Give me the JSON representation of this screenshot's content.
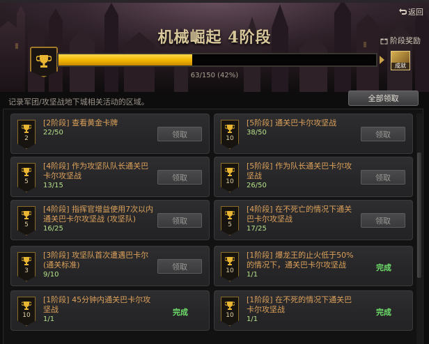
{
  "header": {
    "back_label": "返回",
    "title": "机械崛起 4阶段",
    "reward_label": "阶段奖励",
    "progress": {
      "current": 63,
      "total": 150,
      "percent": 42,
      "text": "63/150 (42%)"
    },
    "achievement_badge_label": "成就"
  },
  "description": "记录军团/攻坚战地下城相关活动的区域。",
  "claim_all_label": "全部领取",
  "colors": {
    "accent_gold": "#f0b400",
    "title": "#d8c79a",
    "task_name": "#dca15a",
    "progress_text": "#b7e18a",
    "complete": "#6ee06b"
  },
  "tasks": [
    {
      "level": "2",
      "name": "[2阶段] 查看黄金卡牌",
      "progress": "22/50",
      "status": "claim",
      "status_label": "领取"
    },
    {
      "level": "10",
      "name": "[5阶段] 通关巴卡尔攻坚战",
      "progress": "38/50",
      "status": "claim",
      "status_label": "领取"
    },
    {
      "level": "5",
      "name": "[4阶段] 作为攻坚队队长通关巴卡尔攻坚战",
      "progress": "13/15",
      "status": "claim",
      "status_label": "领取"
    },
    {
      "level": "10",
      "name": "[5阶段] 作为队长通关巴卡尔攻坚战",
      "progress": "26/50",
      "status": "claim",
      "status_label": "领取"
    },
    {
      "level": "5",
      "name": "[4阶段] 指挥官增益使用7次以内通关巴卡尔攻坚战 (攻坚队)",
      "progress": "16/25",
      "status": "claim",
      "status_label": "领取"
    },
    {
      "level": "5",
      "name": "[4阶段] 在不死亡的情况下通关巴卡尔攻坚战",
      "progress": "17/25",
      "status": "claim",
      "status_label": "领取"
    },
    {
      "level": "3",
      "name": "[3阶段] 攻坚队首次遭遇巴卡尔 (通关标准)",
      "progress": "9/10",
      "status": "claim",
      "status_label": "领取"
    },
    {
      "level": "10",
      "name": "[1阶段] 爆龙王的止火低于50%的情况下，通关巴卡尔攻坚战",
      "progress": "1/1",
      "status": "complete",
      "status_label": "完成"
    },
    {
      "level": "10",
      "name": "[1阶段] 45分钟内通关巴卡尔攻坚战",
      "progress": "1/1",
      "status": "complete",
      "status_label": "完成"
    },
    {
      "level": "10",
      "name": "[1阶段] 在不死的情况下通关巴卡尔攻坚战",
      "progress": "1/1",
      "status": "complete",
      "status_label": "完成"
    }
  ],
  "icons": {
    "back": "back-arrow-icon",
    "reward": "gift-icon",
    "trophy": "trophy-icon"
  }
}
